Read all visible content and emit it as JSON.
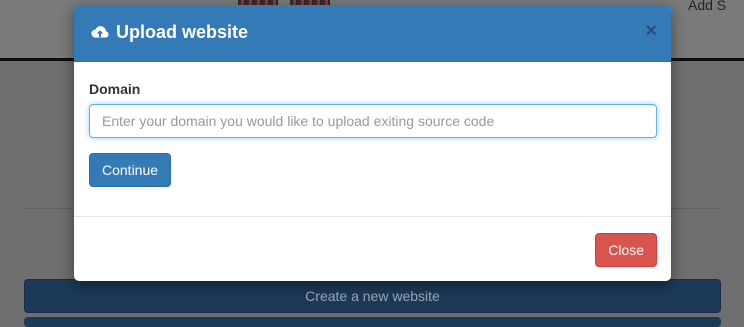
{
  "background": {
    "create_button_label": "Create a new website",
    "corner_text": "Add S"
  },
  "modal": {
    "title": "Upload website",
    "close_glyph": "×",
    "domain_label": "Domain",
    "domain_value": "",
    "domain_placeholder": "Enter your domain you would like to upload exiting source code",
    "continue_label": "Continue",
    "close_label": "Close"
  },
  "colors": {
    "header": "#337ab7",
    "primary_button": "#337ab7",
    "danger_button": "#d9534f"
  },
  "icons": {
    "title_icon": "cloud-upload-icon"
  }
}
